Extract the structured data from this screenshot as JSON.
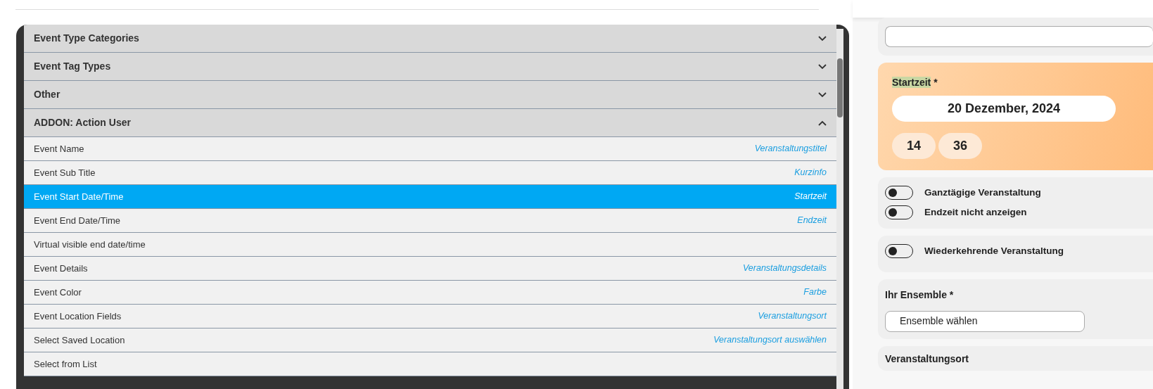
{
  "sections": [
    {
      "label": "Event Type Categories",
      "expanded": false
    },
    {
      "label": "Event Tag Types",
      "expanded": false
    },
    {
      "label": "Other",
      "expanded": false
    },
    {
      "label": "ADDON: Action User",
      "expanded": true
    }
  ],
  "items": [
    {
      "label": "Event Name",
      "mapping": "Veranstaltungstitel",
      "selected": false
    },
    {
      "label": "Event Sub Title",
      "mapping": "Kurzinfo",
      "selected": false
    },
    {
      "label": "Event Start Date/Time",
      "mapping": "Startzeit",
      "selected": true
    },
    {
      "label": "Event End Date/Time",
      "mapping": "Endzeit",
      "selected": false
    },
    {
      "label": "Virtual visible end date/time",
      "selected": false
    },
    {
      "label": "Event Details",
      "mapping": "Veranstaltungsdetails",
      "selected": false
    },
    {
      "label": "Event Color",
      "mapping": "Farbe",
      "selected": false
    },
    {
      "label": "Event Location Fields",
      "mapping": "Veranstaltungsort",
      "selected": false
    },
    {
      "label": "Select Saved Location",
      "mapping": "Veranstaltungsort auswählen",
      "selected": false
    },
    {
      "label": "Select from List",
      "selected": false
    }
  ],
  "form": {
    "start_time": {
      "label": "Startzeit",
      "required_mark": "*",
      "date": "20 Dezember, 2024",
      "hour": "14",
      "minute": "36"
    },
    "toggle_groups": [
      [
        {
          "label": "Ganztägige Veranstaltung",
          "on": false
        },
        {
          "label": "Endzeit nicht anzeigen",
          "on": false
        }
      ],
      [
        {
          "label": "Wiederkehrende Veranstaltung",
          "on": false
        }
      ]
    ],
    "ensemble": {
      "label": "Ihr Ensemble *",
      "value": "Ensemble wählen"
    },
    "location": {
      "label": "Veranstaltungsort"
    }
  }
}
